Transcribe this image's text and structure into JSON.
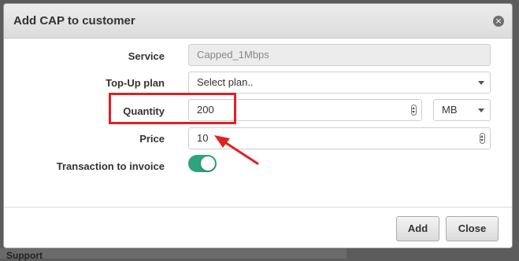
{
  "background": {
    "behind_label": "Support"
  },
  "modal": {
    "title": "Add CAP to customer",
    "close_glyph": "×"
  },
  "form": {
    "service": {
      "label": "Service",
      "value": "Capped_1Mbps"
    },
    "topup_plan": {
      "label": "Top-Up plan",
      "value": "Select plan.."
    },
    "quantity": {
      "label": "Quantity",
      "value": "200",
      "unit": "MB"
    },
    "price": {
      "label": "Price",
      "value": "10"
    },
    "transaction": {
      "label": "Transaction to invoice",
      "enabled": true
    }
  },
  "buttons": {
    "add": "Add",
    "close": "Close"
  },
  "colors": {
    "toggle_on": "#2fa37a",
    "annotation": "#e02020"
  }
}
